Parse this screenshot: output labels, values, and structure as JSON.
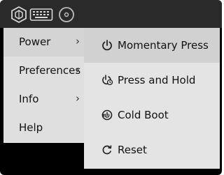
{
  "toolbar": {
    "icons": [
      "hex-logo-icon",
      "keyboard-icon",
      "disc-icon"
    ]
  },
  "menu": {
    "items": [
      {
        "label": "Power",
        "arrow": "›"
      },
      {
        "label": "Preferences",
        "arrow": "›"
      },
      {
        "label": "Info",
        "arrow": "›"
      },
      {
        "label": "Help"
      }
    ]
  },
  "submenu": {
    "items": [
      {
        "label": "Momentary Press",
        "icon": "power-icon"
      },
      {
        "label": "Press and Hold",
        "icon": "press-hold-icon"
      },
      {
        "label": "Cold Boot",
        "icon": "cold-boot-icon"
      },
      {
        "label": "Reset",
        "icon": "reset-icon"
      }
    ]
  },
  "colors": {
    "toolbar_bg": "#2a2a2a",
    "menu_bg": "#dfdfdf",
    "submenu_bg": "#e4e4e4",
    "highlight": "#d1d1d1"
  }
}
